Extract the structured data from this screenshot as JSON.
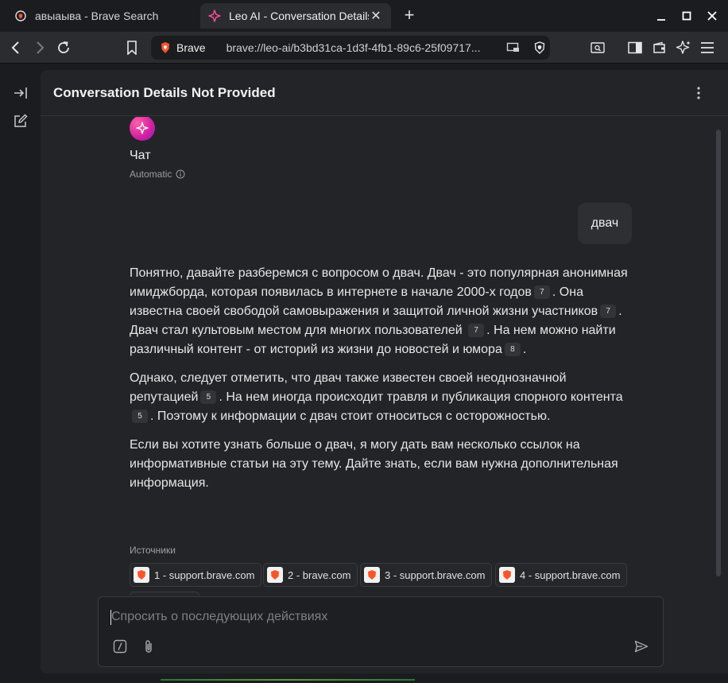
{
  "browser": {
    "tabs": [
      {
        "title": "авыаыва - Brave Search",
        "favicon": "brave-search-icon",
        "active": false
      },
      {
        "title": "Leo AI - Conversation Details Not Provided",
        "favicon": "leo-ai-icon",
        "active": true
      }
    ],
    "address_bar": {
      "brand": "Brave",
      "url": "brave://leo-ai/b3bd31ca-1d3f-4fb1-89c6-25f09717..."
    }
  },
  "conversation": {
    "title": "Conversation Details Not Provided",
    "model": {
      "name": "Чат",
      "mode": "Automatic"
    },
    "user_message": "двач",
    "answer": {
      "p1": {
        "a": "Понятно, давайте разберемся с вопросом о двач. Двач - это популярная анонимная имиджборда, которая появилась в интернете в начале 2000-х годов",
        "c1": "7",
        "b": ". Она известна своей свободой самовыражения и защитой личной жизни участников",
        "c2": "7",
        "c": ". Двач стал культовым местом для многих пользователей",
        "c3": "7",
        "d": ". На нем можно найти различный контент - от историй из жизни до новостей и юмора",
        "c4": "8",
        "e": "."
      },
      "p2": {
        "a": "Однако, следует отметить, что двач также известен своей неоднозначной репутацией",
        "c1": "5",
        "b": ". На нем иногда происходит травля и публикация спорного контента",
        "c2": "5",
        "c": ". Поэтому к информации с двач стоит относиться с осторожностью."
      },
      "p3": "Если вы хотите узнать больше о двач, я могу дать вам несколько ссылок на информативные статьи на эту тему. Дайте знать, если вам нужна дополнительная информация."
    },
    "sources_label": "Источники",
    "sources": [
      "1 - support.brave.com",
      "2 - brave.com",
      "3 - support.brave.com",
      "4 - support.brave.com"
    ]
  },
  "composer": {
    "placeholder": "Спросить о последующих действиях"
  },
  "colors": {
    "accent": "#d11ea0",
    "background": "#1b1c1f",
    "panel": "#232427"
  }
}
